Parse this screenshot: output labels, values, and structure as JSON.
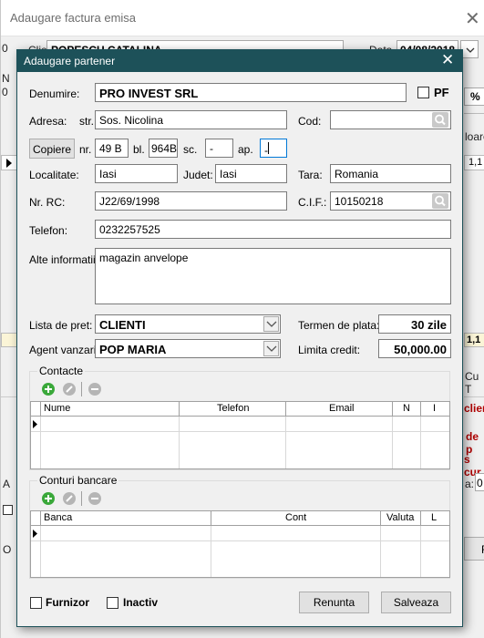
{
  "parent": {
    "title": "Adaugare factura emisa",
    "close": "✕",
    "fragments": {
      "client_label": "Client",
      "client_value": "POPESCU CATALINA",
      "date_label": "Data",
      "date_value": "04/08/2018",
      "ml1": "0",
      "ml2": "N",
      "ml3": "0",
      "pct": "%",
      "col_valoare": "loare",
      "total1": "1,1",
      "total2": "1,1",
      "cu": "Cu T",
      "red1": "clien",
      "red2": "de p",
      "red3": "s cur",
      "a_label": "A",
      "a2_label": "a:",
      "a2_value": "0",
      "o_label": "O",
      "r_label": "R"
    }
  },
  "dialog": {
    "title": "Adaugare partener",
    "close_icon": "✕",
    "denumire_label": "Denumire:",
    "denumire_value": "PRO INVEST SRL",
    "pf_label": "PF",
    "adresa_label": "Adresa:",
    "str_label": "str.",
    "str_value": "Sos. Nicolina",
    "cod_label": "Cod:",
    "cod_value": "",
    "copiere_button": "Copiere",
    "nr_label": "nr.",
    "nr_value": "49 B",
    "bl_label": "bl.",
    "bl_value": "964B",
    "sc_label": "sc.",
    "sc_value": "-",
    "ap_label": "ap.",
    "ap_value": "-",
    "localitate_label": "Localitate:",
    "localitate_value": "Iasi",
    "judet_label": "Judet:",
    "judet_value": "Iasi",
    "tara_label": "Tara:",
    "tara_value": "Romania",
    "nrrc_label": "Nr. RC:",
    "nrrc_value": "J22/69/1998",
    "cif_label": "C.I.F.:",
    "cif_value": "10150218",
    "telefon_label": "Telefon:",
    "telefon_value": "0232257525",
    "alte_label": "Alte informatii:",
    "alte_value": "magazin anvelope",
    "lista_label": "Lista de pret:",
    "lista_value": "CLIENTI",
    "termen_label": "Termen de plata:",
    "termen_value": "30 zile",
    "agent_label": "Agent vanzari:",
    "agent_value": "POP MARIA",
    "limita_label": "Limita credit:",
    "limita_value": "50,000.00",
    "contacte_title": "Contacte",
    "contacte_cols": [
      "Nume",
      "Telefon",
      "Email",
      "N",
      "I"
    ],
    "conturi_title": "Conturi bancare",
    "conturi_cols": [
      "Banca",
      "Cont",
      "Valuta",
      "L"
    ],
    "furnizor_label": "Furnizor",
    "inactiv_label": "Inactiv",
    "renunta_button": "Renunta",
    "salveaza_button": "Salveaza",
    "colors": {
      "titlebar": "#1d5159",
      "add_icon": "#3aa83a",
      "disabled_icon": "#b5b5b5"
    }
  }
}
